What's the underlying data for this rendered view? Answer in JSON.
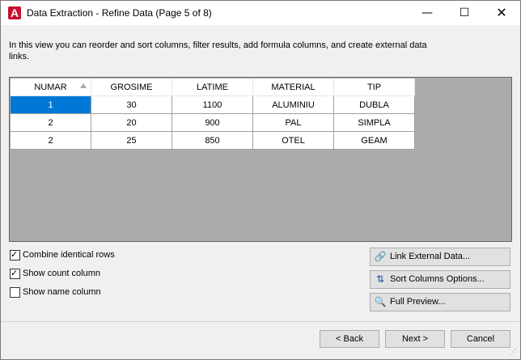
{
  "window": {
    "title": "Data Extraction - Refine Data (Page 5 of 8)",
    "app_icon_letter": "A",
    "controls": {
      "minimize": "—",
      "maximize": "☐",
      "close": "✕"
    }
  },
  "intro_text": "In this view you can reorder and sort columns, filter results, add formula columns, and create external data links.",
  "grid": {
    "columns": [
      "NUMAR",
      "GROSIME",
      "LATIME",
      "MATERIAL",
      "TIP"
    ],
    "rows": [
      [
        "1",
        "30",
        "1100",
        "ALUMINIU",
        "DUBLA"
      ],
      [
        "2",
        "20",
        "900",
        "PAL",
        "SIMPLA"
      ],
      [
        "2",
        "25",
        "850",
        "OTEL",
        "GEAM"
      ]
    ],
    "sorted_column": "NUMAR",
    "sort_direction": "ascending",
    "selected_cell": {
      "row": 0,
      "column": 0
    },
    "selection_color": "#0078d7",
    "empty_area_color": "#ababab"
  },
  "options": {
    "combine_identical_rows": {
      "label": "Combine identical rows",
      "checked": true
    },
    "show_count_column": {
      "label": "Show count column",
      "checked": true
    },
    "show_name_column": {
      "label": "Show name column",
      "checked": false
    }
  },
  "side_buttons": {
    "link_external": {
      "label": "Link External Data...",
      "icon": "link-icon"
    },
    "sort_columns": {
      "label": "Sort Columns Options...",
      "icon": "sort-az-icon"
    },
    "full_preview": {
      "label": "Full Preview...",
      "icon": "preview-icon"
    }
  },
  "nav": {
    "back": "< Back",
    "next": "Next >",
    "cancel": "Cancel"
  }
}
